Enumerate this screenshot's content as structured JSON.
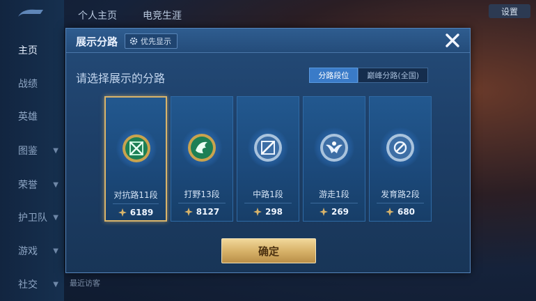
{
  "sidebar": {
    "items": [
      {
        "label": "主页",
        "has_chevron": false,
        "active": true
      },
      {
        "label": "战绩",
        "has_chevron": false
      },
      {
        "label": "英雄",
        "has_chevron": false
      },
      {
        "label": "图鉴",
        "has_chevron": true
      },
      {
        "label": "荣誉",
        "has_chevron": true
      },
      {
        "label": "护卫队",
        "has_chevron": true
      },
      {
        "label": "游戏",
        "has_chevron": true
      },
      {
        "label": "社交",
        "has_chevron": true
      }
    ]
  },
  "top_tabs": [
    "个人主页",
    "电竞生涯"
  ],
  "top_right": {
    "settings_label": "设置"
  },
  "background_text": "最近访客",
  "dialog": {
    "title": "展示分路",
    "priority_button": "优先显示",
    "subtitle": "请选择展示的分路",
    "segments": [
      {
        "label": "分路段位",
        "active": true
      },
      {
        "label": "巅峰分路(全国)",
        "active": false
      }
    ],
    "cards": [
      {
        "name": "对抗路11段",
        "score": "6189",
        "icon": "sword-cross-emblem-icon",
        "selected": true,
        "accent": "#2fbf7a"
      },
      {
        "name": "打野13段",
        "score": "8127",
        "icon": "dragon-emblem-icon",
        "selected": false,
        "accent": "#2fbf7a"
      },
      {
        "name": "中路1段",
        "score": "298",
        "icon": "mid-lane-emblem-icon",
        "selected": false,
        "accent": "#6fa8e6"
      },
      {
        "name": "游走1段",
        "score": "269",
        "icon": "support-wings-emblem-icon",
        "selected": false,
        "accent": "#6fa8e6"
      },
      {
        "name": "发育路2段",
        "score": "680",
        "icon": "marksman-target-emblem-icon",
        "selected": false,
        "accent": "#6fa8e6"
      }
    ],
    "confirm_label": "确定"
  },
  "colors": {
    "gold": "#d9b46a",
    "accent_blue": "#3a7bc8"
  }
}
